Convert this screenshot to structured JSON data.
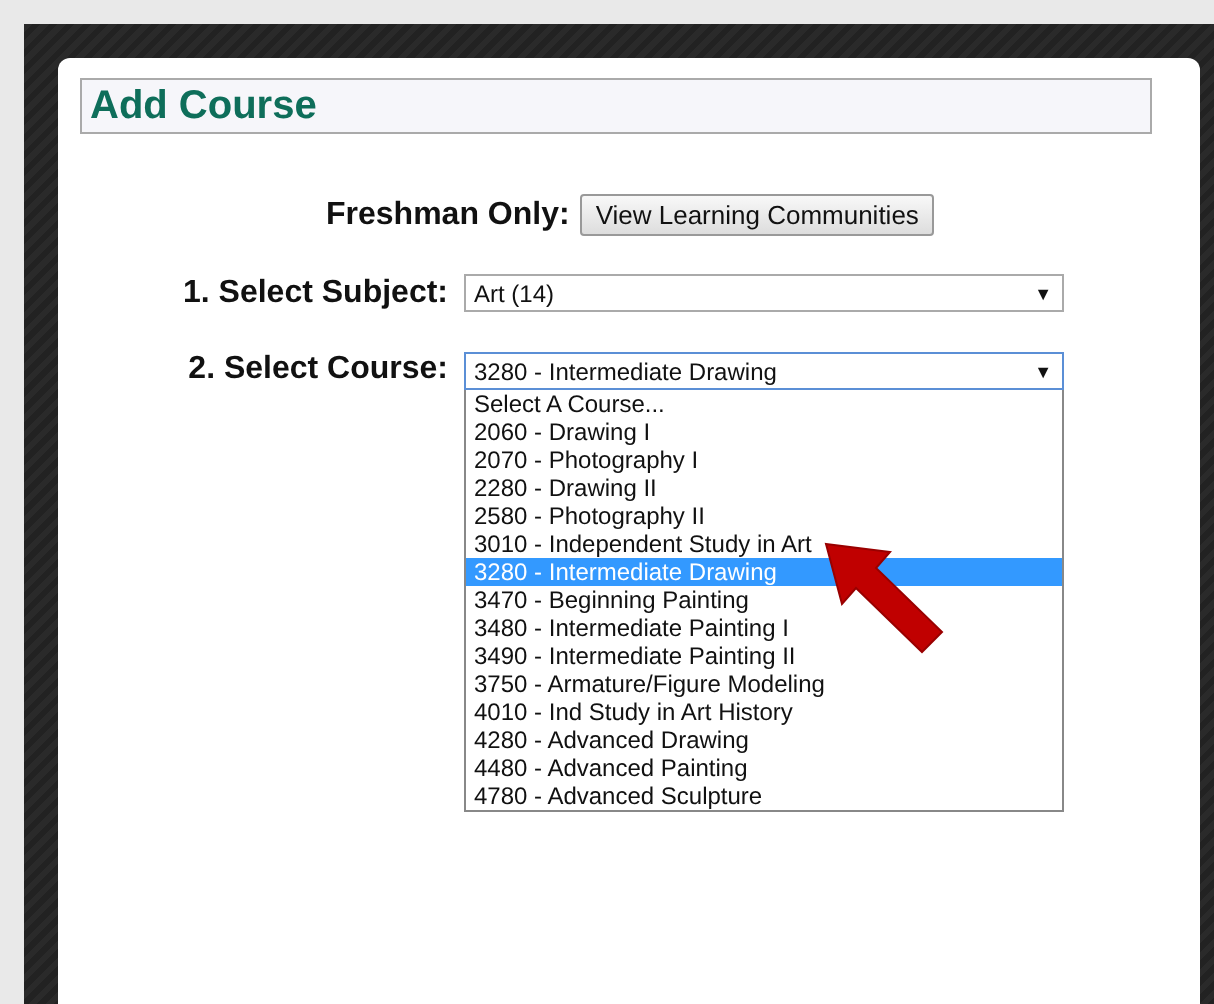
{
  "dialog": {
    "title": "Add Course"
  },
  "freshman": {
    "label": "Freshman Only:",
    "button": "View Learning Communities"
  },
  "subject": {
    "label": "1. Select Subject:",
    "value": "Art (14)",
    "arrow": "▼"
  },
  "course": {
    "label": "2. Select Course:",
    "value": "3280 - Intermediate Drawing",
    "arrow": "▼",
    "expanded": true,
    "options": [
      {
        "label": "Select A Course...",
        "selected": false
      },
      {
        "label": "2060 - Drawing I",
        "selected": false
      },
      {
        "label": "2070 - Photography I",
        "selected": false
      },
      {
        "label": "2280 - Drawing II",
        "selected": false
      },
      {
        "label": "2580 - Photography II",
        "selected": false
      },
      {
        "label": "3010 - Independent Study in Art",
        "selected": false
      },
      {
        "label": "3280 - Intermediate Drawing",
        "selected": true
      },
      {
        "label": "3470 - Beginning Painting",
        "selected": false
      },
      {
        "label": "3480 - Intermediate Painting I",
        "selected": false
      },
      {
        "label": "3490 - Intermediate Painting II",
        "selected": false
      },
      {
        "label": "3750 - Armature/Figure Modeling",
        "selected": false
      },
      {
        "label": "4010 - Ind Study in Art History",
        "selected": false
      },
      {
        "label": "4280 - Advanced Drawing",
        "selected": false
      },
      {
        "label": "4480 - Advanced Painting",
        "selected": false
      },
      {
        "label": "4780 - Advanced Sculpture",
        "selected": false
      }
    ]
  }
}
